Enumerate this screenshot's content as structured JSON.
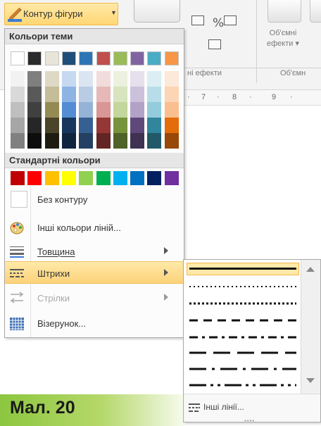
{
  "ribbon": {
    "dropdown_label": "Контур фігури",
    "effects_label_1": "Об'ємні",
    "effects_label_2": "ефекти",
    "group_shadow": "ні ефекти",
    "group_3d": "Об'ємн",
    "ruler_marks": [
      "7",
      "8",
      "9"
    ]
  },
  "menu": {
    "theme_header": "Кольори теми",
    "standard_header": "Стандартні кольори",
    "theme_top": [
      "#ffffff",
      "#2b2b2b",
      "#e8e4d8",
      "#1f4e79",
      "#2e75b6",
      "#c0504d",
      "#9bbb59",
      "#8064a2",
      "#4bacc6",
      "#f79646"
    ],
    "theme_shades": [
      [
        "#f2f2f2",
        "#d9d9d9",
        "#bfbfbf",
        "#a6a6a6",
        "#808080"
      ],
      [
        "#7f7f7f",
        "#595959",
        "#404040",
        "#262626",
        "#0d0d0d"
      ],
      [
        "#ddd9c4",
        "#c4bd97",
        "#948b54",
        "#4a452a",
        "#1e1c11"
      ],
      [
        "#c6d9f1",
        "#8eb4e3",
        "#548dd4",
        "#17365d",
        "#0f243e"
      ],
      [
        "#dbe5f1",
        "#b8cce4",
        "#95b3d7",
        "#366092",
        "#244062"
      ],
      [
        "#f2dcdb",
        "#e6b9b8",
        "#d99694",
        "#953735",
        "#632523"
      ],
      [
        "#ebf1de",
        "#d7e4bd",
        "#c3d69b",
        "#77933c",
        "#4f6228"
      ],
      [
        "#e6e0ec",
        "#ccc1da",
        "#b3a2c7",
        "#5f497a",
        "#3f3151"
      ],
      [
        "#dbeef4",
        "#b7dee8",
        "#93cddd",
        "#31859c",
        "#215968"
      ],
      [
        "#fde9d9",
        "#fcd5b5",
        "#fabf8f",
        "#e46c0a",
        "#984807"
      ]
    ],
    "standard_colors": [
      "#c00000",
      "#ff0000",
      "#ffc000",
      "#ffff00",
      "#92d050",
      "#00b050",
      "#00b0f0",
      "#0070c0",
      "#002060",
      "#7030a0"
    ],
    "no_outline": "Без контуру",
    "more_colors": "Інші кольори ліній...",
    "weight": "Товщина",
    "dashes": "Штрихи",
    "arrows": "Стрілки",
    "pattern": "Візерунок..."
  },
  "dash_menu": {
    "more_lines": "Інші лінії..."
  },
  "caption": "Мал. 20"
}
